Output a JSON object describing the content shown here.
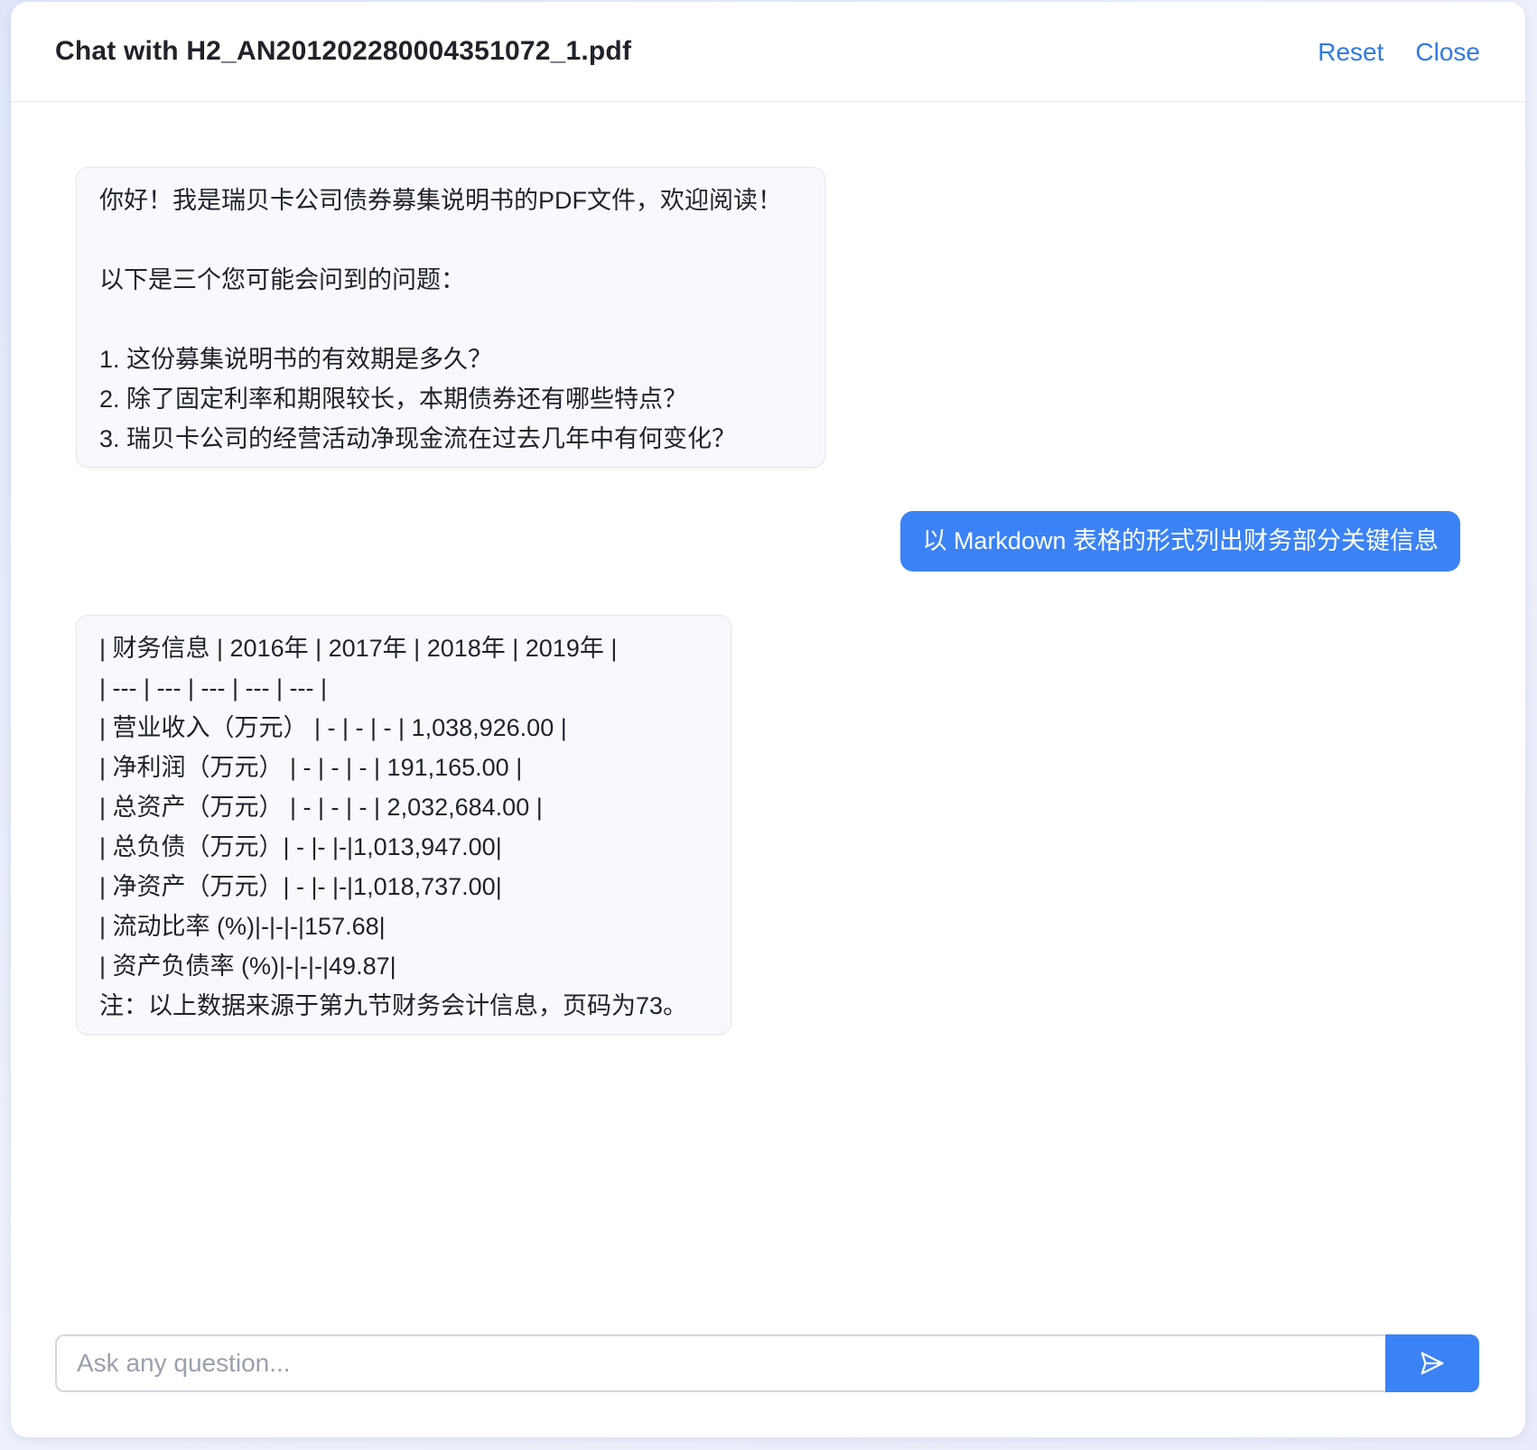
{
  "header": {
    "title": "Chat with H2_AN201202280004351072_1.pdf",
    "reset_label": "Reset",
    "close_label": "Close"
  },
  "messages": [
    {
      "role": "assistant",
      "lines": [
        "你好！我是瑞贝卡公司债券募集说明书的PDF文件，欢迎阅读！",
        "",
        "以下是三个您可能会问到的问题：",
        "",
        "1. 这份募集说明书的有效期是多久？",
        "2. 除了固定利率和期限较长，本期债券还有哪些特点？",
        "3. 瑞贝卡公司的经营活动净现金流在过去几年中有何变化？"
      ]
    },
    {
      "role": "user",
      "text": "以 Markdown 表格的形式列出财务部分关键信息"
    },
    {
      "role": "assistant",
      "lines": [
        "| 财务信息 | 2016年 | 2017年 | 2018年 | 2019年 |",
        "| --- | --- | --- | --- | --- |",
        "| 营业收入（万元） | - | - | - | 1,038,926.00 |",
        "| 净利润（万元） | - | - | - | 191,165.00 |",
        "| 总资产（万元） | - | - | - | 2,032,684.00 |",
        "| 总负债（万元）| - |- |-|1,013,947.00|",
        "| 净资产（万元）| - |- |-|1,018,737.00|",
        "| 流动比率 (%)|-|-|-|157.68|",
        "| 资产负债率 (%)|-|-|-|49.87|",
        "注：以上数据来源于第九节财务会计信息，页码为73。"
      ]
    }
  ],
  "composer": {
    "placeholder": "Ask any question...",
    "value": "",
    "send_icon": "send-icon"
  },
  "colors": {
    "accent": "#3b82f6",
    "link": "#2f7ae5",
    "bot_bubble": "#f8f9fd"
  }
}
